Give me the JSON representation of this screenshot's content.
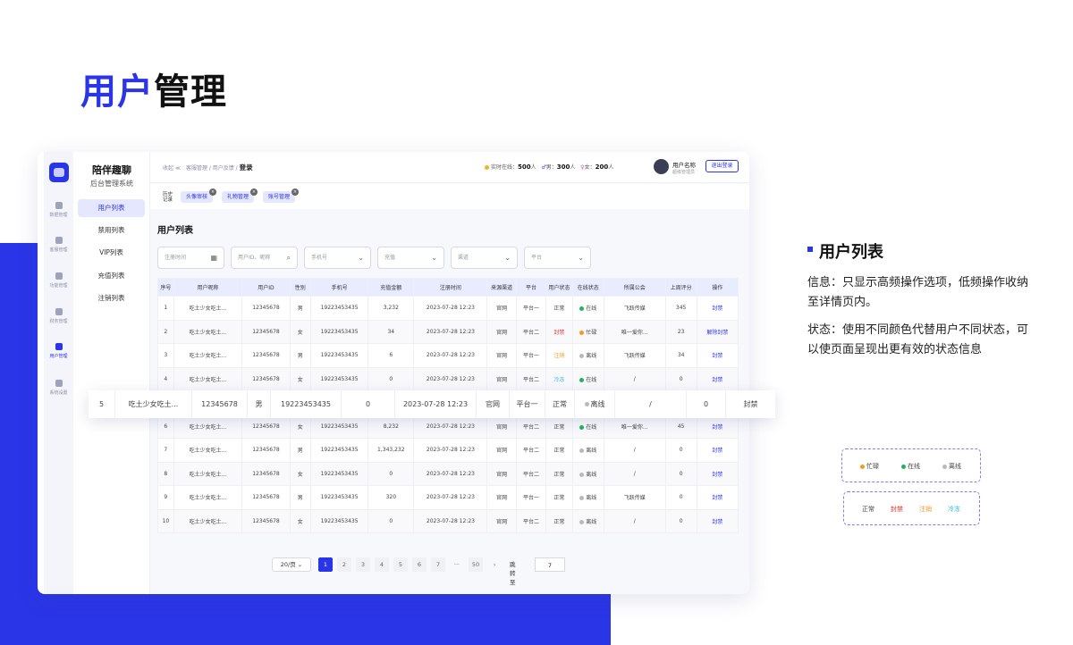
{
  "page_title": {
    "part1": "用户",
    "part2": "管理"
  },
  "sidebar": {
    "items": [
      {
        "label": "数据管理"
      },
      {
        "label": "客服管理"
      },
      {
        "label": "功能管理"
      },
      {
        "label": "财务管理"
      },
      {
        "label": "用户管理"
      },
      {
        "label": "系统设置"
      }
    ]
  },
  "brand": {
    "name": "陪伴趣聊",
    "subtitle": "后台管理系统"
  },
  "menu": {
    "items": [
      {
        "label": "用户列表"
      },
      {
        "label": "禁用列表"
      },
      {
        "label": "VIP列表"
      },
      {
        "label": "充值列表"
      },
      {
        "label": "注销列表"
      }
    ]
  },
  "topbar": {
    "collapse": "收起 ≪",
    "breadcrumb": "客服管理 / 用户反馈 /",
    "breadcrumb_current": "登录",
    "online_label": "实时在线：",
    "online_value": "500",
    "online_unit": "人",
    "male_label": "男：",
    "male_value": "300",
    "male_unit": "人",
    "female_label": "女：",
    "female_value": "200",
    "female_unit": "人",
    "user_name": "用户名称",
    "user_role": "超级管理员",
    "logout": "退出登录"
  },
  "history": {
    "label": "历史记录",
    "tags": [
      {
        "label": "头像审核"
      },
      {
        "label": "礼物管理"
      },
      {
        "label": "账号管理"
      }
    ]
  },
  "list": {
    "title": "用户列表",
    "filters": [
      {
        "placeholder": "注册时间"
      },
      {
        "placeholder": "用户ID、昵称"
      },
      {
        "placeholder": "手机号"
      },
      {
        "placeholder": "充值"
      },
      {
        "placeholder": "渠道"
      },
      {
        "placeholder": "平台"
      }
    ],
    "columns": [
      "序号",
      "用户昵称",
      "用户ID",
      "性别",
      "手机号",
      "充值金额",
      "注册时间",
      "来源渠道",
      "平台",
      "用户状态",
      "在线状态",
      "所属公会",
      "上周评分",
      "操作"
    ],
    "rows": [
      {
        "no": "1",
        "nick": "吃土少女吃土...",
        "id": "12345678",
        "sex": "男",
        "phone": "19223453435",
        "amount": "3,232",
        "time": "2023-07-28 12:23",
        "channel": "官网",
        "platform": "平台一",
        "status": "正常",
        "status_type": "normal",
        "online": "在线",
        "online_color": "#22b35e",
        "guild": "飞跃传媒",
        "score": "345",
        "op": "封禁"
      },
      {
        "no": "2",
        "nick": "吃土少女吃土...",
        "id": "12345678",
        "sex": "女",
        "phone": "19223453435",
        "amount": "34",
        "time": "2023-07-28 12:23",
        "channel": "官网",
        "platform": "平台二",
        "status": "封禁",
        "status_type": "ban",
        "online": "忙碌",
        "online_color": "#f59a23",
        "guild": "唯一爱你...",
        "score": "23",
        "op": "解除封禁"
      },
      {
        "no": "3",
        "nick": "吃土少女吃土...",
        "id": "12345678",
        "sex": "男",
        "phone": "19223453435",
        "amount": "6",
        "time": "2023-07-28 12:23",
        "channel": "官网",
        "platform": "平台一",
        "status": "注销",
        "status_type": "cancel",
        "online": "离线",
        "online_color": "#b5b8c5",
        "guild": "飞跃传媒",
        "score": "34",
        "op": "封禁"
      },
      {
        "no": "4",
        "nick": "吃土少女吃土...",
        "id": "12345678",
        "sex": "女",
        "phone": "19223453435",
        "amount": "0",
        "time": "2023-07-28 12:23",
        "channel": "官网",
        "platform": "平台二",
        "status": "冷冻",
        "status_type": "freeze",
        "online": "在线",
        "online_color": "#22b35e",
        "guild": "/",
        "score": "0",
        "op": "封禁"
      },
      {
        "no": "5",
        "nick": "吃土少女吃土...",
        "id": "12345678",
        "sex": "男",
        "phone": "19223453435",
        "amount": "0",
        "time": "2023-07-28 12:23",
        "channel": "官网",
        "platform": "平台一",
        "status": "正常",
        "status_type": "normal",
        "online": "离线",
        "online_color": "#b5b8c5",
        "guild": "/",
        "score": "0",
        "op": "封禁"
      },
      {
        "no": "6",
        "nick": "吃土少女吃土...",
        "id": "12345678",
        "sex": "女",
        "phone": "19223453435",
        "amount": "8,232",
        "time": "2023-07-28 12:23",
        "channel": "官网",
        "platform": "平台二",
        "status": "正常",
        "status_type": "normal",
        "online": "在线",
        "online_color": "#22b35e",
        "guild": "唯一爱你...",
        "score": "45",
        "op": "封禁"
      },
      {
        "no": "7",
        "nick": "吃土少女吃土...",
        "id": "12345678",
        "sex": "男",
        "phone": "19223453435",
        "amount": "1,343,232",
        "time": "2023-07-28 12:23",
        "channel": "官网",
        "platform": "平台二",
        "status": "正常",
        "status_type": "normal",
        "online": "离线",
        "online_color": "#b5b8c5",
        "guild": "/",
        "score": "0",
        "op": "封禁"
      },
      {
        "no": "8",
        "nick": "吃土少女吃土...",
        "id": "12345678",
        "sex": "女",
        "phone": "19223453435",
        "amount": "0",
        "time": "2023-07-28 12:23",
        "channel": "官网",
        "platform": "平台二",
        "status": "正常",
        "status_type": "normal",
        "online": "离线",
        "online_color": "#b5b8c5",
        "guild": "/",
        "score": "0",
        "op": "封禁"
      },
      {
        "no": "9",
        "nick": "吃土少女吃土...",
        "id": "12345678",
        "sex": "男",
        "phone": "19223453435",
        "amount": "320",
        "time": "2023-07-28 12:23",
        "channel": "官网",
        "platform": "平台一",
        "status": "正常",
        "status_type": "normal",
        "online": "离线",
        "online_color": "#b5b8c5",
        "guild": "飞跃传媒",
        "score": "0",
        "op": "封禁"
      },
      {
        "no": "10",
        "nick": "吃土少女吃土...",
        "id": "12345678",
        "sex": "女",
        "phone": "19223453435",
        "amount": "0",
        "time": "2023-07-28 12:23",
        "channel": "官网",
        "platform": "平台二",
        "status": "正常",
        "status_type": "normal",
        "online": "离线",
        "online_color": "#b5b8c5",
        "guild": "/",
        "score": "0",
        "op": "封禁"
      }
    ]
  },
  "pagination": {
    "page_size": "20/页 ⌄",
    "pages": [
      "1",
      "2",
      "3",
      "4",
      "5",
      "6",
      "7",
      "···",
      "50"
    ],
    "next": "›",
    "jump_label": "跳转至",
    "jump_value": "7"
  },
  "float_row": {
    "no": "5",
    "nick": "吃土少女吃土...",
    "id": "12345678",
    "sex": "男",
    "phone": "19223453435",
    "amount": "0",
    "time": "2023-07-28 12:23",
    "channel": "官网",
    "platform": "平台一",
    "status": "正常",
    "online": "离线",
    "guild": "/",
    "score": "0",
    "op": "封禁"
  },
  "annotation": {
    "title": "用户列表",
    "p1": "信息：只显示高频操作选项，低频操作收纳至详情页内。",
    "p2": "状态：使用不同颜色代替用户不同状态，可以使页面呈现出更有效的状态信息"
  },
  "legend_online": [
    {
      "label": "忙碌",
      "color": "#f59a23"
    },
    {
      "label": "在线",
      "color": "#22b35e"
    },
    {
      "label": "离线",
      "color": "#b5b8c5"
    }
  ],
  "legend_status": [
    {
      "label": "正常",
      "color": "#444444"
    },
    {
      "label": "封禁",
      "color": "#e0312c"
    },
    {
      "label": "注销",
      "color": "#f59a23"
    },
    {
      "label": "冷冻",
      "color": "#2bb6f0"
    }
  ],
  "colors": {
    "accent": "#2a35e8"
  }
}
